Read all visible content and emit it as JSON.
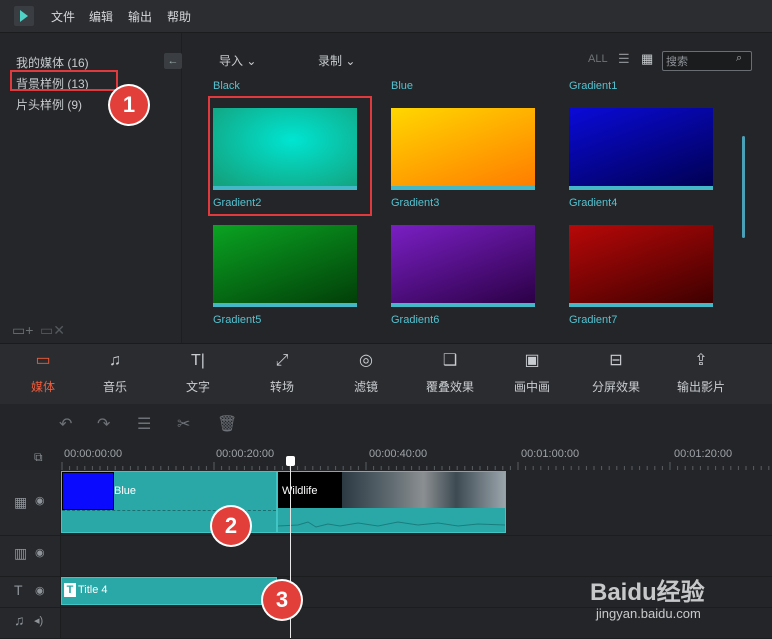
{
  "menu": {
    "items": [
      "文件",
      "编辑",
      "输出",
      "帮助"
    ]
  },
  "library": {
    "items": [
      {
        "label": "我的媒体 (16)"
      },
      {
        "label": "背景样例 (13)"
      },
      {
        "label": "片头样例 (9)"
      }
    ]
  },
  "toolbar": {
    "import_label": "导入",
    "record_label": "录制",
    "all_label": "ALL",
    "search_placeholder": "搜索"
  },
  "media": {
    "top_labels": [
      "Black",
      "Blue",
      "Gradient1"
    ],
    "items": [
      {
        "label": "Gradient2",
        "colors": [
          "#00e5d2",
          "#13a37f"
        ]
      },
      {
        "label": "Gradient3",
        "colors": [
          "#ffd700",
          "#ff7b00"
        ]
      },
      {
        "label": "Gradient4",
        "colors": [
          "#0a0ad8",
          "#000050"
        ]
      },
      {
        "label": "Gradient5",
        "colors": [
          "#0aa322",
          "#023d08"
        ]
      },
      {
        "label": "Gradient6",
        "colors": [
          "#7a1fc4",
          "#2a0044"
        ]
      },
      {
        "label": "Gradient7",
        "colors": [
          "#b80808",
          "#3c0000"
        ]
      }
    ]
  },
  "tabs": [
    {
      "label": "媒体",
      "icon": "folder-icon",
      "glyph": "▭"
    },
    {
      "label": "音乐",
      "icon": "music-note-icon",
      "glyph": "♫"
    },
    {
      "label": "文字",
      "icon": "text-icon",
      "glyph": "T|"
    },
    {
      "label": "转场",
      "icon": "transition-icon",
      "glyph": "⤢"
    },
    {
      "label": "滤镜",
      "icon": "filter-icon",
      "glyph": "◎"
    },
    {
      "label": "覆叠效果",
      "icon": "overlay-icon",
      "glyph": "❑"
    },
    {
      "label": "画中画",
      "icon": "pip-icon",
      "glyph": "▣"
    },
    {
      "label": "分屏效果",
      "icon": "split-screen-icon",
      "glyph": "⊟"
    },
    {
      "label": "输出影片",
      "icon": "export-icon",
      "glyph": "⇪"
    }
  ],
  "timeline": {
    "times": [
      "00:00:00:00",
      "00:00:20:00",
      "00:00:40:00",
      "00:01:00:00",
      "00:01:20:00"
    ],
    "clips": {
      "blue": "Blue",
      "wildlife": "Wildlife",
      "title": "Title 4"
    }
  },
  "annotations": [
    "1",
    "2",
    "3"
  ],
  "watermark": {
    "brand": "Baidu经验",
    "url": "jingyan.baidu.com"
  }
}
